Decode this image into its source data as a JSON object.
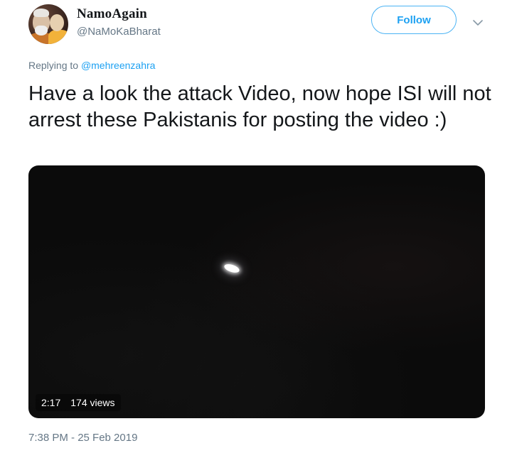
{
  "author": {
    "display_name": "NamoAgain",
    "handle": "@NaMoKaBharat",
    "avatar_icon": "profile-photo"
  },
  "follow_button": {
    "label": "Follow",
    "color": "#1da1f2"
  },
  "menu": {
    "icon": "chevron-down-icon"
  },
  "reply": {
    "prefix": "Replying to ",
    "mention": "@mehreenzahra"
  },
  "tweet": {
    "text": "Have a look the attack Video, now hope ISI will not arrest these Pakistanis for posting the video :)"
  },
  "video": {
    "duration": "2:17",
    "views": "174 views"
  },
  "meta": {
    "timestamp": "7:38 PM - 25 Feb 2019"
  },
  "colors": {
    "accent": "#1da1f2",
    "secondary_text": "#657786",
    "primary_text": "#14171a"
  }
}
